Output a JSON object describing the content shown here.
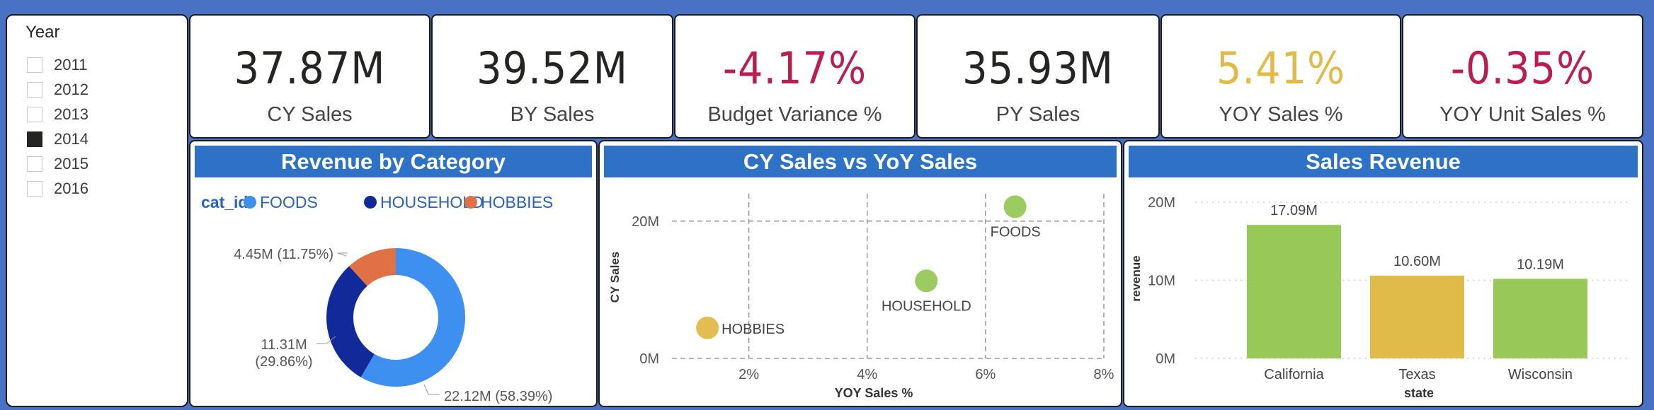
{
  "slicer": {
    "title": "Year",
    "items": [
      {
        "label": "2011",
        "checked": false
      },
      {
        "label": "2012",
        "checked": false
      },
      {
        "label": "2013",
        "checked": false
      },
      {
        "label": "2014",
        "checked": true
      },
      {
        "label": "2015",
        "checked": false
      },
      {
        "label": "2016",
        "checked": false
      }
    ]
  },
  "kpis": [
    {
      "value": "37.87M",
      "label": "CY Sales",
      "color": "#252423"
    },
    {
      "value": "39.52M",
      "label": "BY Sales",
      "color": "#252423"
    },
    {
      "value": "-4.17%",
      "label": "Budget Variance %",
      "color": "#b81e4e"
    },
    {
      "value": "35.93M",
      "label": "PY Sales",
      "color": "#252423"
    },
    {
      "value": "5.41%",
      "label": "YOY Sales %",
      "color": "#e0bb49"
    },
    {
      "value": "-0.35%",
      "label": "YOY Unit Sales %",
      "color": "#b81e4e"
    }
  ],
  "revenue_by_category": {
    "title": "Revenue by Category",
    "legend_title": "cat_id",
    "legend": [
      {
        "name": "FOODS",
        "color": "#3d8ff0"
      },
      {
        "name": "HOUSEHOLD",
        "color": "#12299a"
      },
      {
        "name": "HOBBIES",
        "color": "#df7145"
      }
    ]
  },
  "cy_vs_yoy": {
    "title": "CY Sales vs YoY Sales"
  },
  "sales_revenue": {
    "title": "Sales Revenue"
  },
  "chart_data": [
    {
      "type": "pie",
      "title": "Revenue by Category",
      "categories": [
        "FOODS",
        "HOUSEHOLD",
        "HOBBIES"
      ],
      "values": [
        22.12,
        11.31,
        4.45
      ],
      "labels": [
        "22.12M (58.39%)",
        "11.31M (29.86%)",
        "4.45M (11.75%)"
      ],
      "colors": [
        "#3d8ff0",
        "#12299a",
        "#df7145"
      ],
      "legend": "top-left"
    },
    {
      "type": "scatter",
      "title": "CY Sales vs YoY Sales",
      "xlabel": "YOY Sales %",
      "ylabel": "CY Sales",
      "xlim": [
        0.7,
        8
      ],
      "ylim": [
        0,
        24
      ],
      "xticks": [
        "2%",
        "4%",
        "6%",
        "8%"
      ],
      "yticks": [
        "0M",
        "20M"
      ],
      "points": [
        {
          "label": "FOODS",
          "x": 6.5,
          "y": 22.1,
          "color": "#97c858"
        },
        {
          "label": "HOUSEHOLD",
          "x": 5.0,
          "y": 11.3,
          "color": "#97c858"
        },
        {
          "label": "HOBBIES",
          "x": 1.3,
          "y": 4.45,
          "color": "#e0bb49"
        }
      ]
    },
    {
      "type": "bar",
      "title": "Sales Revenue",
      "xlabel": "state",
      "ylabel": "revenue",
      "categories": [
        "California",
        "Texas",
        "Wisconsin"
      ],
      "values": [
        17.09,
        10.6,
        10.19
      ],
      "data_labels": [
        "17.09M",
        "10.60M",
        "10.19M"
      ],
      "colors": [
        "#97c858",
        "#e0bb49",
        "#97c858"
      ],
      "yticks": [
        "0M",
        "10M",
        "20M"
      ],
      "ylim": [
        0,
        20
      ]
    }
  ]
}
